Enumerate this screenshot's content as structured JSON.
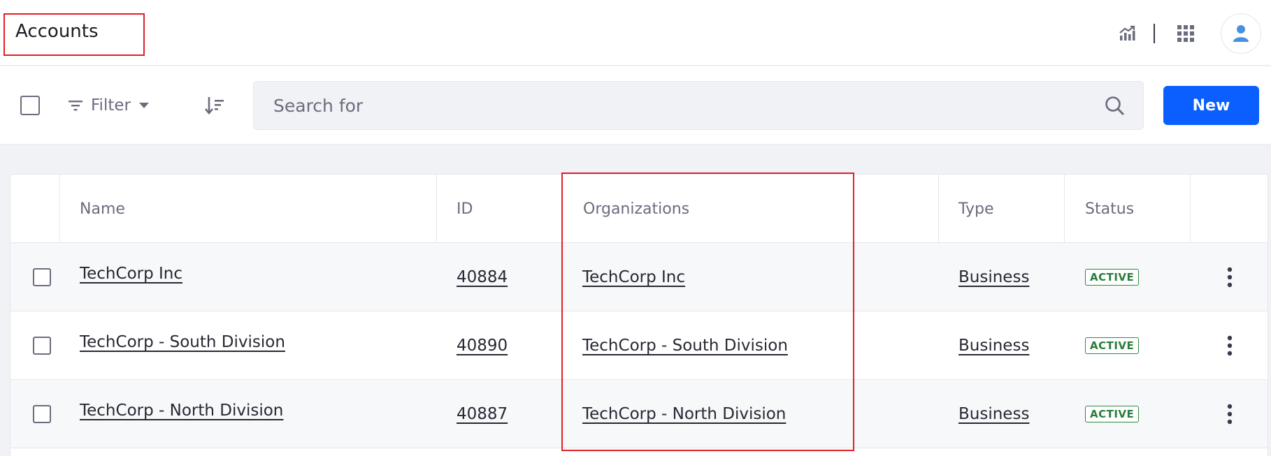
{
  "header": {
    "title": "Accounts"
  },
  "top_actions": {
    "analytics_icon": "chart-icon",
    "apps_icon": "apps-grid-icon",
    "user_icon": "user-avatar-icon"
  },
  "toolbar": {
    "filter_label": "Filter",
    "search_placeholder": "Search for",
    "new_label": "New"
  },
  "table": {
    "columns": {
      "name": "Name",
      "id": "ID",
      "organizations": "Organizations",
      "type": "Type",
      "status": "Status"
    },
    "rows": [
      {
        "name": "TechCorp Inc",
        "id": "40884",
        "organization": "TechCorp Inc",
        "type": "Business",
        "status": "ACTIVE"
      },
      {
        "name": "TechCorp - South Division",
        "id": "40890",
        "organization": "TechCorp - South Division",
        "type": "Business",
        "status": "ACTIVE"
      },
      {
        "name": "TechCorp - North Division",
        "id": "40887",
        "organization": "TechCorp - North Division",
        "type": "Business",
        "status": "ACTIVE"
      }
    ]
  },
  "colors": {
    "accent": "#0b5fff",
    "highlight_box": "#e01f26",
    "status_active": "#287d3c"
  }
}
